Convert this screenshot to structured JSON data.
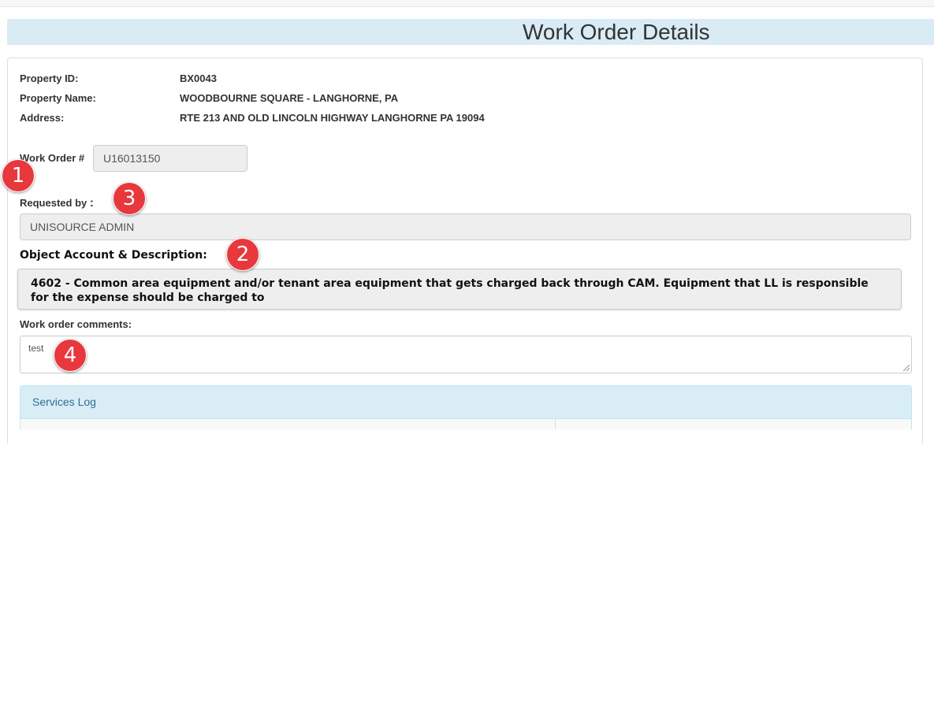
{
  "page": {
    "title": "Work Order Details"
  },
  "property": {
    "id_label": "Property ID:",
    "id_value": "BX0043",
    "name_label": "Property Name:",
    "name_value": "WOODBOURNE SQUARE - LANGHORNE, PA",
    "address_label": "Address:",
    "address_value": "RTE 213 AND OLD LINCOLN HIGHWAY LANGHORNE PA 19094"
  },
  "work_order": {
    "label": "Work Order #",
    "value": "U16013150"
  },
  "requested_by": {
    "label": "Requested by",
    "colon": ":",
    "value": "UNISOURCE ADMIN"
  },
  "object_account": {
    "label": "Object Account & Description:",
    "description": "4602 - Common area equipment and/or tenant area equipment that gets charged back through CAM.  Equipment that LL is responsible for the expense should be charged to"
  },
  "comments": {
    "label": "Work order comments:",
    "value": "test"
  },
  "services_log": {
    "title": "Services Log"
  },
  "annotations": [
    "1",
    "2",
    "3",
    "4"
  ],
  "colors": {
    "badge": "#e8383d",
    "title_bar": "#d9ebf5",
    "services_header": "#d9edf7"
  }
}
